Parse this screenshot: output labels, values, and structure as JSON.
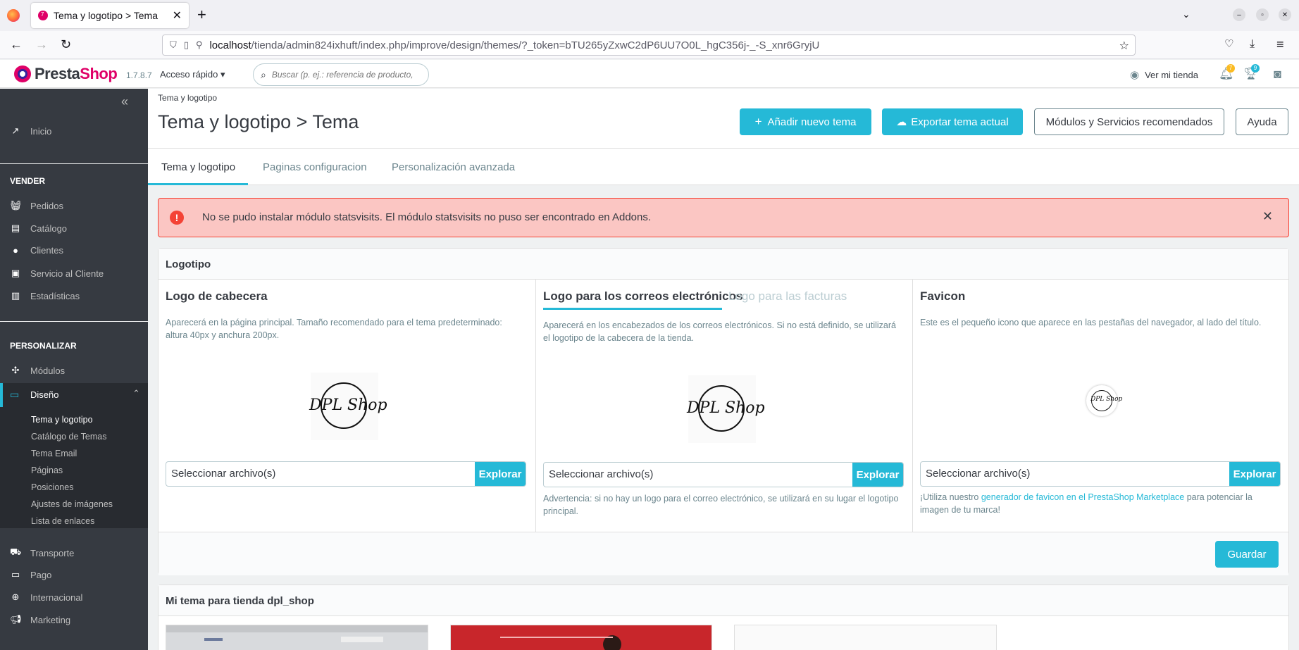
{
  "browser": {
    "tab_title": "Tema y logotipo > Tema",
    "url_host": "localhost",
    "url_rest": "/tienda/admin824ixhuft/index.php/improve/design/themes/?_token=bTU265yZxwC2dP6UU7O0L_hgC356j-_-S_xnr6GryjU"
  },
  "header": {
    "brand_part1": "Presta",
    "brand_part2": "Shop",
    "version": "1.7.8.7",
    "quick_access": "Acceso rápido",
    "search_placeholder": "Buscar (p. ej.: referencia de producto,",
    "view_shop": "Ver mi tienda",
    "notif_count": "7",
    "trophy_count": "9"
  },
  "sidebar": {
    "home": "Inicio",
    "section_sell": "VENDER",
    "sell_items": [
      "Pedidos",
      "Catálogo",
      "Clientes",
      "Servicio al Cliente",
      "Estadísticas"
    ],
    "section_customize": "PERSONALIZAR",
    "modules": "Módulos",
    "design": "Diseño",
    "design_sub": [
      "Tema y logotipo",
      "Catálogo de Temas",
      "Tema Email",
      "Páginas",
      "Posiciones",
      "Ajustes de imágenes",
      "Lista de enlaces"
    ],
    "after_items": [
      "Transporte",
      "Pago",
      "Internacional",
      "Marketing"
    ]
  },
  "page": {
    "breadcrumb": "Tema y logotipo",
    "title": "Tema y logotipo > Tema",
    "btn_add_theme": "Añadir nuevo tema",
    "btn_export": "Exportar tema actual",
    "btn_modules": "Módulos y Servicios recomendados",
    "btn_help": "Ayuda",
    "tabs": [
      "Tema y logotipo",
      "Paginas configuracion",
      "Personalización avanzada"
    ]
  },
  "alert": {
    "text": "No se pudo instalar módulo statsvisits. El módulo statsvisits no puso ser encontrado en Addons."
  },
  "logo_card": {
    "title": "Logotipo",
    "header_logo": {
      "title": "Logo de cabecera",
      "desc": "Aparecerá en la página principal. Tamaño recomendado para el tema predeterminado: altura 40px y anchura 200px."
    },
    "email_logo": {
      "title": "Logo para los correos electrónicos",
      "title_alt": "Logo para las facturas",
      "desc": "Aparecerá en los encabezados de los correos electrónicos. Si no está definido, se utilizará el logotipo de la cabecera de la tienda.",
      "note": "Advertencia: si no hay un logo para el correo electrónico, se utilizará en su lugar el logotipo principal."
    },
    "favicon": {
      "title": "Favicon",
      "desc": "Este es el pequeño icono que aparece en las pestañas del navegador, al lado del título.",
      "note_before": "¡Utiliza nuestro ",
      "note_link": "generador de favicon en el PrestaShop Marketplace",
      "note_after": " para potenciar la imagen de tu marca!"
    },
    "logo_text": "DPL Shop",
    "file_placeholder": "Seleccionar archivo(s)",
    "browse": "Explorar",
    "save": "Guardar"
  },
  "theme_card": {
    "title": "Mi tema para tienda dpl_shop"
  },
  "colors": {
    "accent": "#25b9d7",
    "sidebar": "#363a41",
    "danger": "#f44336",
    "brand_pink": "#df0067"
  }
}
